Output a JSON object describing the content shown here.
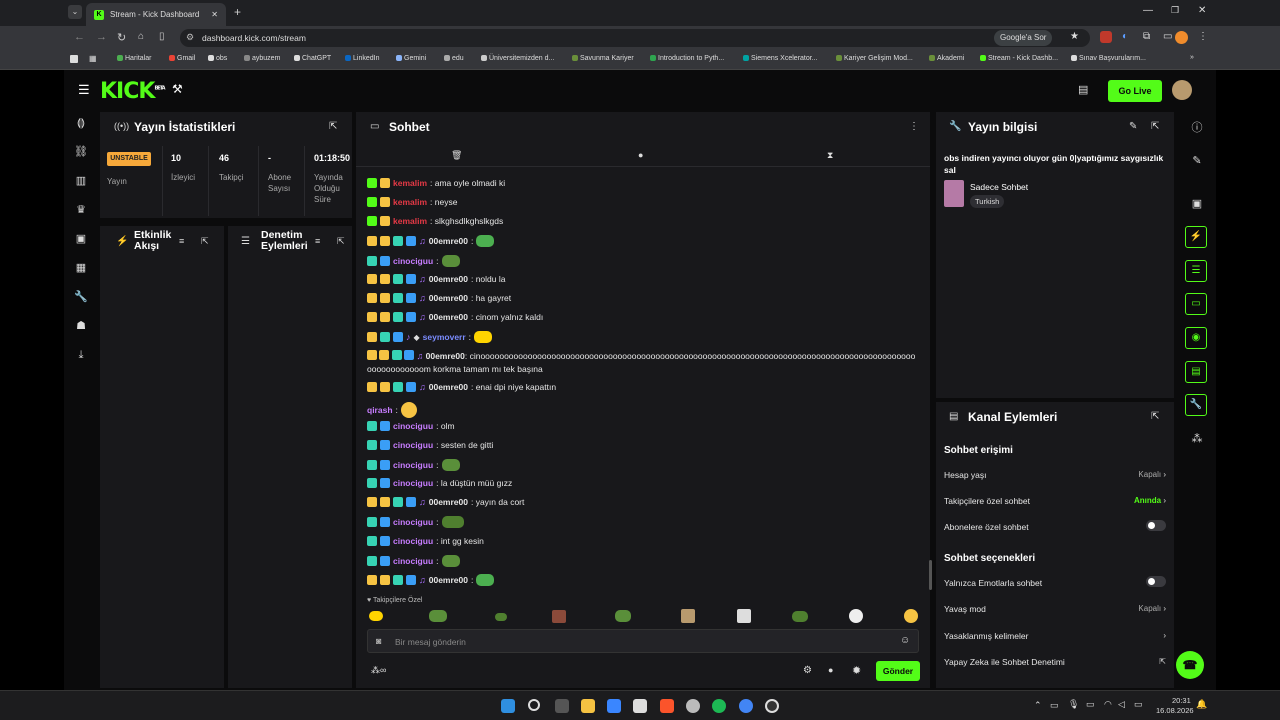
{
  "browser": {
    "tab_title": "Stream - Kick Dashboard",
    "url": "dashboard.kick.com/stream",
    "search_chip": "Google'a Sor",
    "bookmarks": [
      "Haritalar",
      "Gmail",
      "obs",
      "aybuzem",
      "ChatGPT",
      "LinkedIn",
      "Gemini",
      "edu",
      "Üniversitemizden d...",
      "Savunma Kariyer",
      "Introduction to Pyth...",
      "Siemens Xcelerator...",
      "Kariyer Gelişim Mod...",
      "Akademi",
      "Stream - Kick Dashb...",
      "Sınav Başvurularım..."
    ]
  },
  "topnav": {
    "logo": "KICK",
    "logo_sup": "BETA",
    "go_live": "Go Live"
  },
  "stats": {
    "title": "Yayın İstatistikleri",
    "status_badge": "UNSTABLE",
    "status_label": "Yayın",
    "viewers_value": "10",
    "viewers_label": "İzleyici",
    "followers_value": "46",
    "followers_label": "Takipçi",
    "subs_value": "-",
    "subs_label": "Abone Sayısı",
    "duration_value": "01:18:50",
    "duration_label": "Yayında Olduğu Süre"
  },
  "activity": {
    "title": "Etkinlik Akışı"
  },
  "moderation": {
    "title": "Denetim Eylemleri"
  },
  "chat": {
    "title": "Sohbet",
    "messages": [
      {
        "user": "kemalim",
        "text": ": ama oyle olmadi ki",
        "color": "#e63946"
      },
      {
        "user": "kemalim",
        "text": ": neyse",
        "color": "#e63946"
      },
      {
        "user": "kemalim",
        "text": ": slkghsdlkghslkgds",
        "color": "#e63946"
      },
      {
        "user": "00emre00",
        "text": ":",
        "color": "#ffffff"
      },
      {
        "user": "cinociguu",
        "text": ":",
        "color": "#c77dff"
      },
      {
        "user": "00emre00",
        "text": ": noldu la",
        "color": "#ffffff"
      },
      {
        "user": "00emre00",
        "text": ": ha gayret",
        "color": "#ffffff"
      },
      {
        "user": "00emre00",
        "text": ": cinom yalnız kaldı",
        "color": "#ffffff"
      },
      {
        "user": "seymoverr",
        "text": ":",
        "color": "#7b8cff"
      },
      {
        "user": "00emre00",
        "text": ": cinoooooooooooooooooooooooooooooooooooooooooooooooooooooooooooooooooooooooooooooooooooooooooooooooooooooooom korkma tamam mı tek başına",
        "color": "#ffffff"
      },
      {
        "user": "00emre00",
        "text": ": enai dpi niye kapattın",
        "color": "#ffffff"
      },
      {
        "user": "qirash",
        "text": ":",
        "color": "#c77dff"
      },
      {
        "user": "cinociguu",
        "text": ": olm",
        "color": "#c77dff"
      },
      {
        "user": "cinociguu",
        "text": ": sesten de gitti",
        "color": "#c77dff"
      },
      {
        "user": "cinociguu",
        "text": ":",
        "color": "#c77dff"
      },
      {
        "user": "cinociguu",
        "text": ": la düştün müü gızz",
        "color": "#c77dff"
      },
      {
        "user": "00emre00",
        "text": ": yayın da cort",
        "color": "#ffffff"
      },
      {
        "user": "cinociguu",
        "text": ":",
        "color": "#c77dff"
      },
      {
        "user": "cinociguu",
        "text": ": int gg kesin",
        "color": "#c77dff"
      },
      {
        "user": "cinociguu",
        "text": ":",
        "color": "#c77dff"
      },
      {
        "user": "00emre00",
        "text": ":",
        "color": "#ffffff"
      }
    ],
    "followers_only_label": "Takipçilere Özel",
    "input_placeholder": "Bir mesaj gönderin",
    "send_label": "Gönder"
  },
  "stream_info": {
    "title": "Yayın bilgisi",
    "stream_title": "obs indiren yayıncı oluyor gün 0|yaptığımız saygısızlık sal",
    "category": "Sadece Sohbet",
    "language": "Turkish"
  },
  "channel_actions": {
    "title": "Kanal Eylemleri",
    "chat_access_head": "Sohbet erişimi",
    "account_age": "Hesap yaşı",
    "account_age_value": "Kapalı",
    "followers_chat": "Takipçilere özel sohbet",
    "followers_chat_value": "Anında",
    "subs_chat": "Abonelere özel sohbet",
    "chat_options_head": "Sohbet seçenekleri",
    "emote_only": "Yalnızca Emotlarla sohbet",
    "slow_mode": "Yavaş mod",
    "slow_mode_value": "Kapalı",
    "banned_words": "Yasaklanmış kelimeler",
    "ai_moderation": "Yapay Zeka ile Sohbet Denetimi"
  },
  "taskbar": {
    "time": "20:31",
    "date": "16.08.2026"
  }
}
